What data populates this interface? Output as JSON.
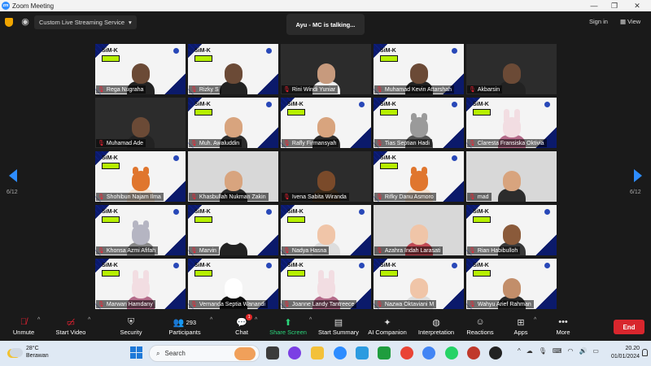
{
  "titlebar": {
    "app_title": "Zoom Meeting",
    "logo_text": "zm"
  },
  "topbar": {
    "stream_label": "Custom Live Streaming Service",
    "talking": "Ayu - MC is talking...",
    "signin": "Sign in",
    "view": "View"
  },
  "pagination": {
    "left": "6/12",
    "right": "6/12"
  },
  "tile_branding": {
    "logo": "SiM-K"
  },
  "participants": [
    {
      "name": "Rega Nugraha",
      "bg": "sim",
      "avatar": "camera-person"
    },
    {
      "name": "Rizky S",
      "bg": "sim",
      "avatar": "camera-person"
    },
    {
      "name": "Rini Windi Yuniar",
      "bg": "camera",
      "avatar": "camera-woman"
    },
    {
      "name": "Muhamad Kevin Attarshah",
      "bg": "sim",
      "avatar": "camera-person"
    },
    {
      "name": "Akbarsin",
      "bg": "camera",
      "avatar": "camera-person"
    },
    {
      "name": "Muhamad Ade",
      "bg": "camera",
      "avatar": "camera-person"
    },
    {
      "name": "Muh. Awaluddin",
      "bg": "sim",
      "avatar": "memoji-man"
    },
    {
      "name": "Rafly Firmansyah",
      "bg": "sim",
      "avatar": "memoji-man"
    },
    {
      "name": "Tias Septian Hadi",
      "bg": "sim",
      "avatar": "raccoon"
    },
    {
      "name": "Claresta Fransiska Oktivia",
      "bg": "sim",
      "avatar": "bunny"
    },
    {
      "name": "Shohibun Najam Ilma",
      "bg": "sim",
      "avatar": "fox"
    },
    {
      "name": "Khasbullah Nukman Zakin",
      "bg": "grey",
      "avatar": "memoji-man"
    },
    {
      "name": "Ivena Sabita Wiranda",
      "bg": "camera",
      "avatar": "bear"
    },
    {
      "name": "Rifky Danu Asmoro",
      "bg": "sim",
      "avatar": "fox"
    },
    {
      "name": "mad",
      "bg": "grey",
      "avatar": "memoji-man"
    },
    {
      "name": "Khonsa Azmi Afifah",
      "bg": "sim",
      "avatar": "cat"
    },
    {
      "name": "Marvin",
      "bg": "sim",
      "avatar": "cow"
    },
    {
      "name": "Nadya Hasna",
      "bg": "sim",
      "avatar": "memoji-woman"
    },
    {
      "name": "Azahra Indah Larasati",
      "bg": "grey",
      "avatar": "memoji-hijab"
    },
    {
      "name": "Rian Habibulloh",
      "bg": "sim",
      "avatar": "memoji-dark"
    },
    {
      "name": "Marwan Hamdany",
      "bg": "sim",
      "avatar": "bunny"
    },
    {
      "name": "Vernanda Septia Wanandi",
      "bg": "sim",
      "avatar": "panda"
    },
    {
      "name": "Joanne Landy Tantreece",
      "bg": "sim",
      "avatar": "bunny"
    },
    {
      "name": "Nazwa Oktaviani M",
      "bg": "sim",
      "avatar": "memoji-woman"
    },
    {
      "name": "Wahyu Arief Rahman",
      "bg": "sim",
      "avatar": "memoji-glasses"
    }
  ],
  "toolbar": {
    "unmute": "Unmute",
    "start_video": "Start Video",
    "security": "Security",
    "participants": "Participants",
    "participants_count": "293",
    "chat": "Chat",
    "chat_badge": "1",
    "share_screen": "Share Screen",
    "start_summary": "Start Summary",
    "ai_companion": "AI Companion",
    "interpretation": "Interpretation",
    "reactions": "Reactions",
    "apps": "Apps",
    "more": "More",
    "end": "End"
  },
  "taskbar": {
    "temperature": "28°C",
    "weather": "Berawan",
    "search_placeholder": "Search",
    "time": "20.20",
    "date": "01/01/2024"
  },
  "colors": {
    "accent": "#2d8cff",
    "end": "#d8262d",
    "share": "#2bd67b",
    "sim_navy": "#0b1a6b",
    "sim_green": "#b6f000"
  }
}
